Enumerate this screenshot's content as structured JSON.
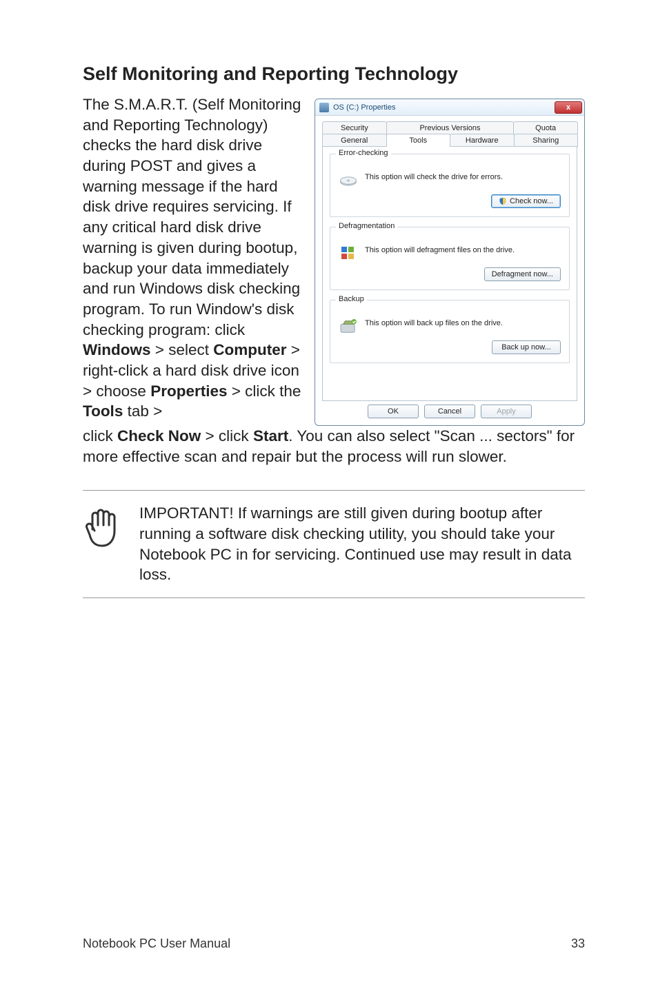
{
  "heading": "Self Monitoring and Reporting Technology",
  "body_html": "The S.M.A.R.T. (Self Monitoring and Reporting Technology) checks the hard disk drive during POST and gives a warning message if the hard disk drive requires servicing. If any critical hard disk drive warning is given during bootup, backup your data immediately and run Windows disk checking program. To run Window's disk checking program: click <b>Windows</b> > select <b>Computer</b> > right-click a hard disk drive icon > choose <b>Properties</b> > click the <b>Tools</b> tab >",
  "continuation_html": "click <b>Check Now</b> > click <b>Start</b>. You can also select \"Scan ... sectors\" for more effective scan and repair but the process will run slower.",
  "note_text": "IMPORTANT! If warnings are still given during bootup after running a software disk checking utility, you should take your Notebook PC in for servicing. Continued use may result in data loss.",
  "dialog": {
    "title": "OS (C:) Properties",
    "close_glyph": "x",
    "tabs_row1": {
      "security": "Security",
      "previous": "Previous Versions",
      "quota": "Quota"
    },
    "tabs_row2": {
      "general": "General",
      "tools": "Tools",
      "hardware": "Hardware",
      "sharing": "Sharing"
    },
    "groups": {
      "error": {
        "legend": "Error-checking",
        "text": "This option will check the drive for errors.",
        "button": "Check now..."
      },
      "defrag": {
        "legend": "Defragmentation",
        "text": "This option will defragment files on the drive.",
        "button": "Defragment now..."
      },
      "backup": {
        "legend": "Backup",
        "text": "This option will back up files on the drive.",
        "button": "Back up now..."
      }
    },
    "footer": {
      "ok": "OK",
      "cancel": "Cancel",
      "apply": "Apply"
    }
  },
  "footer": {
    "left": "Notebook PC User Manual",
    "right": "33"
  }
}
